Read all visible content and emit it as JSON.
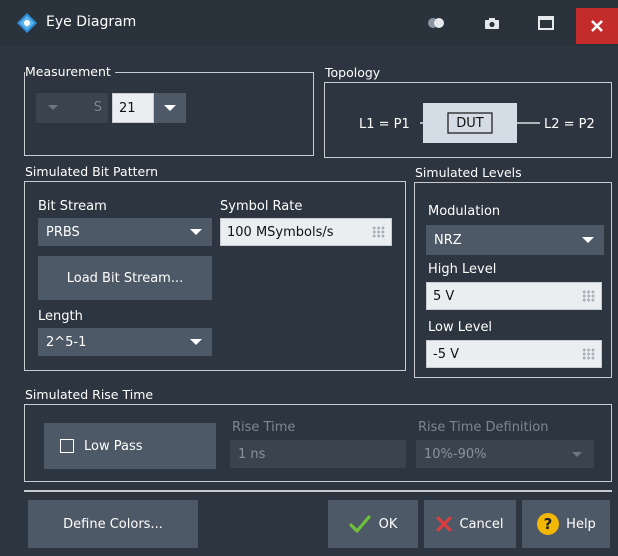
{
  "window": {
    "title": "Eye Diagram"
  },
  "measurement": {
    "label": "Measurement",
    "param_prefix": "S",
    "param_value": "21"
  },
  "topology": {
    "label": "Topology",
    "left": "L1 = P1",
    "dut": "DUT",
    "right": "L2 = P2"
  },
  "bit_pattern": {
    "label": "Simulated Bit Pattern",
    "bit_stream_label": "Bit Stream",
    "bit_stream_value": "PRBS",
    "symbol_rate_label": "Symbol Rate",
    "symbol_rate_value": "100 MSymbols/s",
    "load_button": "Load Bit Stream...",
    "length_label": "Length",
    "length_value": "2^5-1"
  },
  "levels": {
    "label": "Simulated Levels",
    "modulation_label": "Modulation",
    "modulation_value": "NRZ",
    "high_label": "High Level",
    "high_value": "5 V",
    "low_label": "Low Level",
    "low_value": "-5 V"
  },
  "rise_time": {
    "label": "Simulated Rise Time",
    "low_pass_label": "Low Pass",
    "low_pass_checked": false,
    "rise_time_label": "Rise Time",
    "rise_time_value": "1 ns",
    "definition_label": "Rise Time Definition",
    "definition_value": "10%-90%"
  },
  "footer": {
    "define_colors": "Define Colors...",
    "ok": "OK",
    "cancel": "Cancel",
    "help": "Help"
  },
  "colors": {
    "background": "#2d3640",
    "control": "#4d5966",
    "close": "#c42b2b",
    "ok_check": "#6fc03a",
    "cancel_x": "#e03c3c",
    "help_badge": "#f2b705"
  },
  "icons": [
    "app-logo-icon",
    "toggle-icon",
    "camera-icon",
    "maximize-icon",
    "close-icon",
    "chevron-down-icon",
    "keypad-icon",
    "checkmark-icon",
    "x-icon",
    "help-icon"
  ]
}
